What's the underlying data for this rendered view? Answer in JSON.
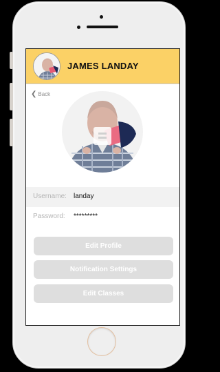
{
  "header": {
    "name": "JAMES LANDAY"
  },
  "nav": {
    "back_label": "Back",
    "back_icon": "chevron-left"
  },
  "profile": {
    "username_label": "Username:",
    "username_value": "landay",
    "password_label": "Password:",
    "password_value": "*********"
  },
  "actions": [
    {
      "label": "Edit Profile"
    },
    {
      "label": "Notification Settings"
    },
    {
      "label": "Edit Classes"
    }
  ],
  "colors": {
    "header": "#fbd166",
    "button": "#dedede",
    "label": "#b5b5b5"
  }
}
